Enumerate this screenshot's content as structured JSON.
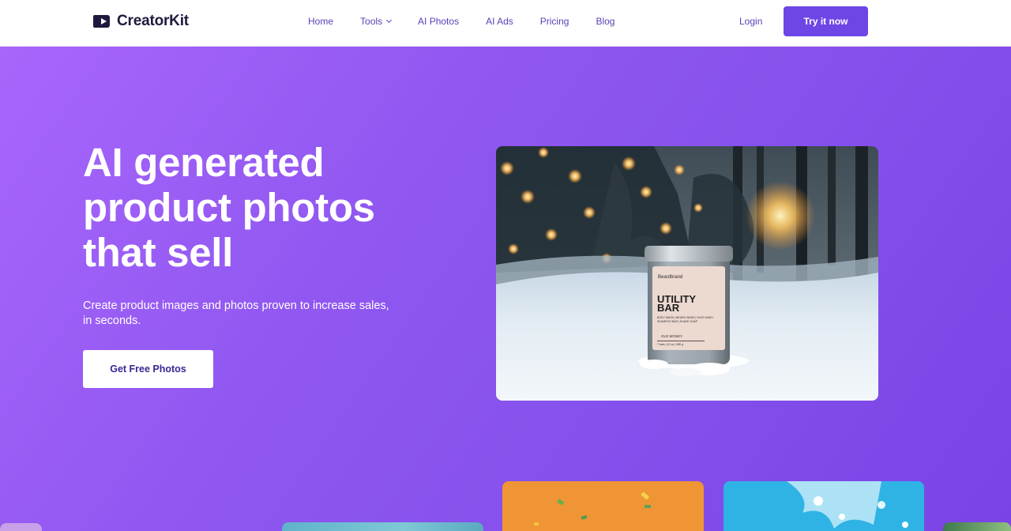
{
  "brand": {
    "name": "CreatorKit"
  },
  "nav": {
    "items": [
      {
        "label": "Home"
      },
      {
        "label": "Tools"
      },
      {
        "label": "AI Photos"
      },
      {
        "label": "AI Ads"
      },
      {
        "label": "Pricing"
      },
      {
        "label": "Blog"
      }
    ],
    "login_label": "Login",
    "try_label": "Try it now"
  },
  "hero": {
    "headline": "AI generated product photos that sell",
    "subtitle": "Create product images and photos proven to increase sales, in seconds.",
    "cta_label": "Get Free Photos",
    "product": {
      "brand_text": "Beardbrand",
      "title_line1": "UTILITY",
      "title_line2": "BAR",
      "small1": "BODY WASH | BEARD WASH | FACE WASH",
      "small2": "SHAMPOO BAR | SHAVE SOAP",
      "scent": "OLD MONEY",
      "weight": "7 bars | 10 oz | 385 g"
    }
  },
  "colors": {
    "accent": "#6e46e6",
    "hero_gradient_start": "#a866fb",
    "hero_gradient_end": "#7a43e5",
    "nav_text": "#5b3fb5",
    "brand_text": "#1f1a3d"
  },
  "icons": {
    "logo": "play-video-icon",
    "dropdown": "chevron-down-icon"
  }
}
